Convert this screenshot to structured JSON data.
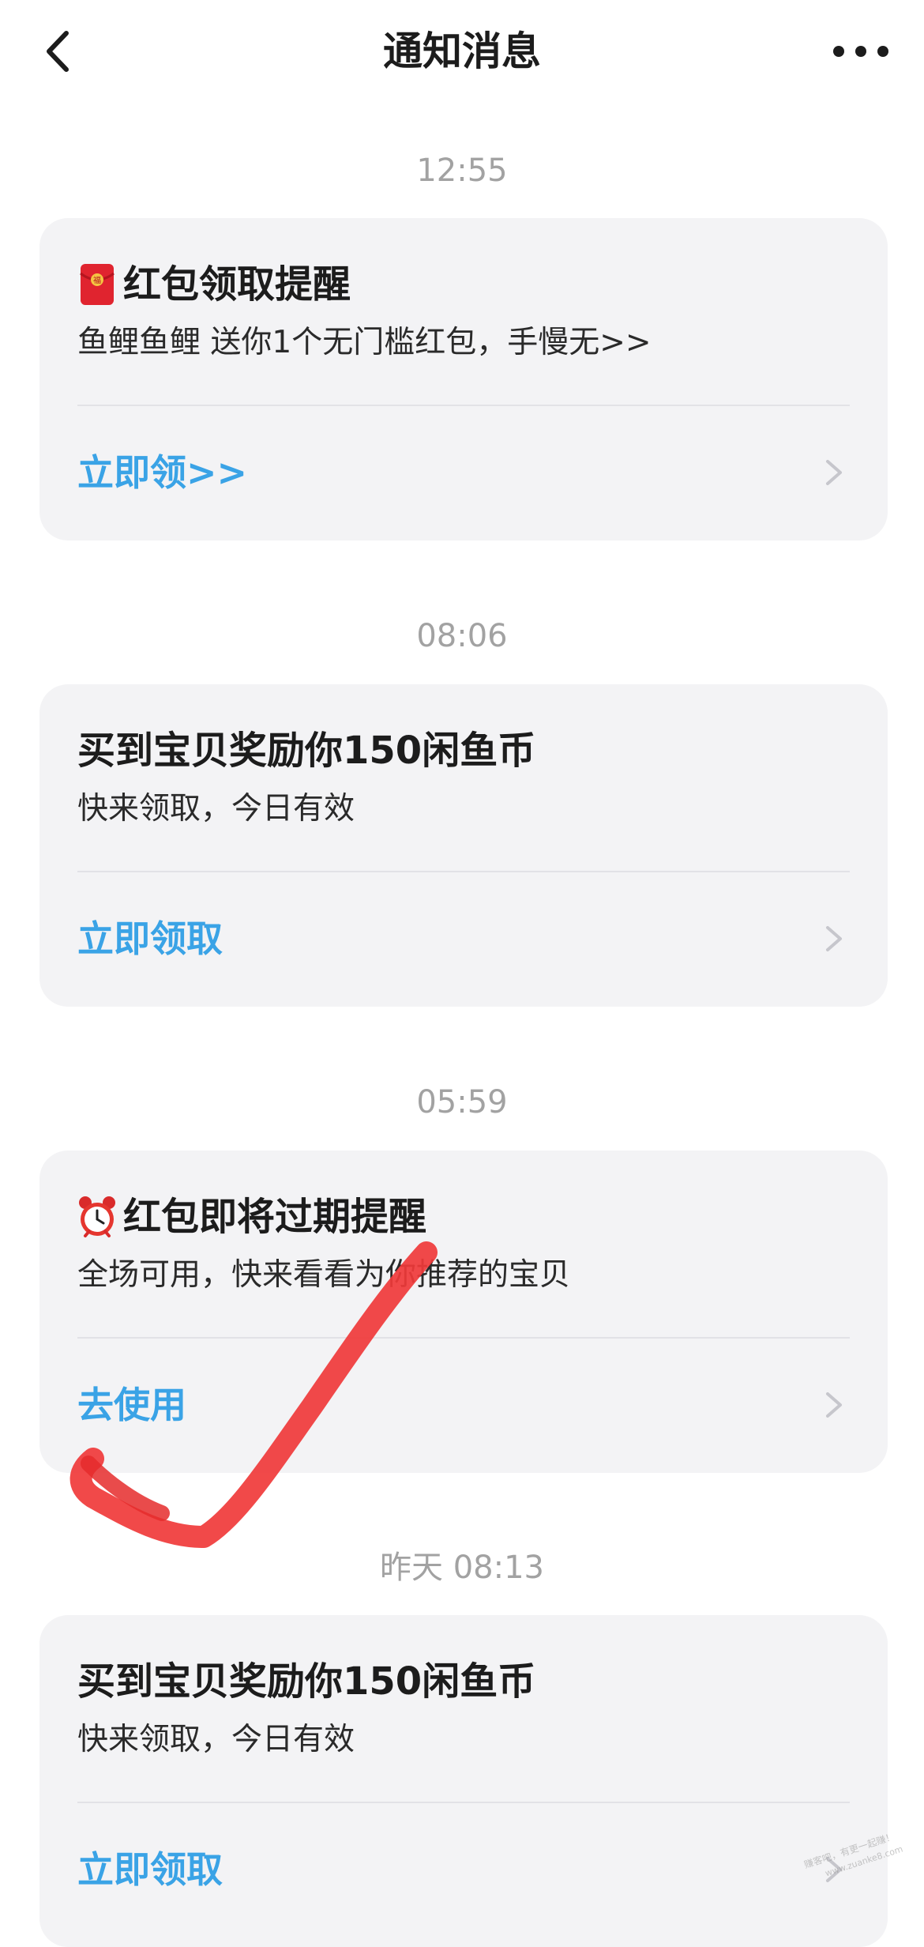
{
  "nav": {
    "title": "通知消息",
    "back_icon": "chevron-left-icon",
    "more_icon": "more-dots-icon"
  },
  "messages": [
    {
      "time": "12:55",
      "emoji": "red-envelope-icon",
      "title": "红包领取提醒",
      "subtitle": "鱼鲤鱼鲤 送你1个无门槛红包，手慢无>>",
      "action": "立即领>>"
    },
    {
      "time": "08:06",
      "emoji": "",
      "title": "买到宝贝奖励你150闲鱼币",
      "subtitle": "快来领取，今日有效",
      "action": "立即领取"
    },
    {
      "time": "05:59",
      "emoji": "alarm-clock-icon",
      "title": "红包即将过期提醒",
      "subtitle": "全场可用，快来看看为你推荐的宝贝",
      "action": "去使用"
    },
    {
      "time": "昨天 08:13",
      "emoji": "",
      "title": "买到宝贝奖励你150闲鱼币",
      "subtitle": "快来领取，今日有效",
      "action": "立即领取"
    }
  ],
  "colors": {
    "accent": "#3aa3e6",
    "card_bg": "#f3f3f5",
    "timestamp": "#a2a2a2",
    "check_mark": "#f03a3a"
  },
  "overlay": {
    "check_mark_icon": "red-checkmark-stroke"
  }
}
